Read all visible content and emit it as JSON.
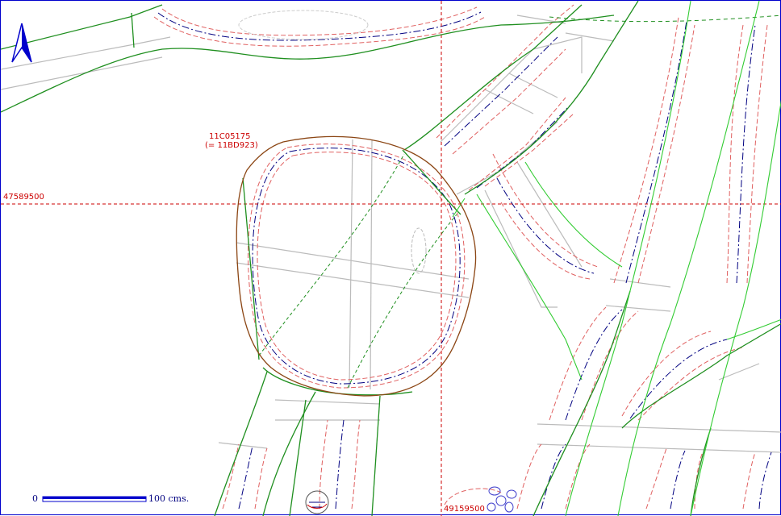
{
  "map": {
    "parcel_label": "11C05175",
    "parcel_alias": "(= 11BD923)",
    "northing_label": "47589500",
    "easting_label": "49159500",
    "scale": {
      "start": "0",
      "end": "100 cms."
    },
    "north_arrow": "north-arrow-icon",
    "colors": {
      "grid": "#cc0000",
      "parcel_boundary": "#8b4513",
      "green_boundary": "#1f8f1f",
      "light_green_boundary": "#33cc33",
      "blue_contour": "#000080",
      "red_contour": "#e06060",
      "gray_lines": "#bbbbbb",
      "frame": "#0000cc"
    }
  }
}
